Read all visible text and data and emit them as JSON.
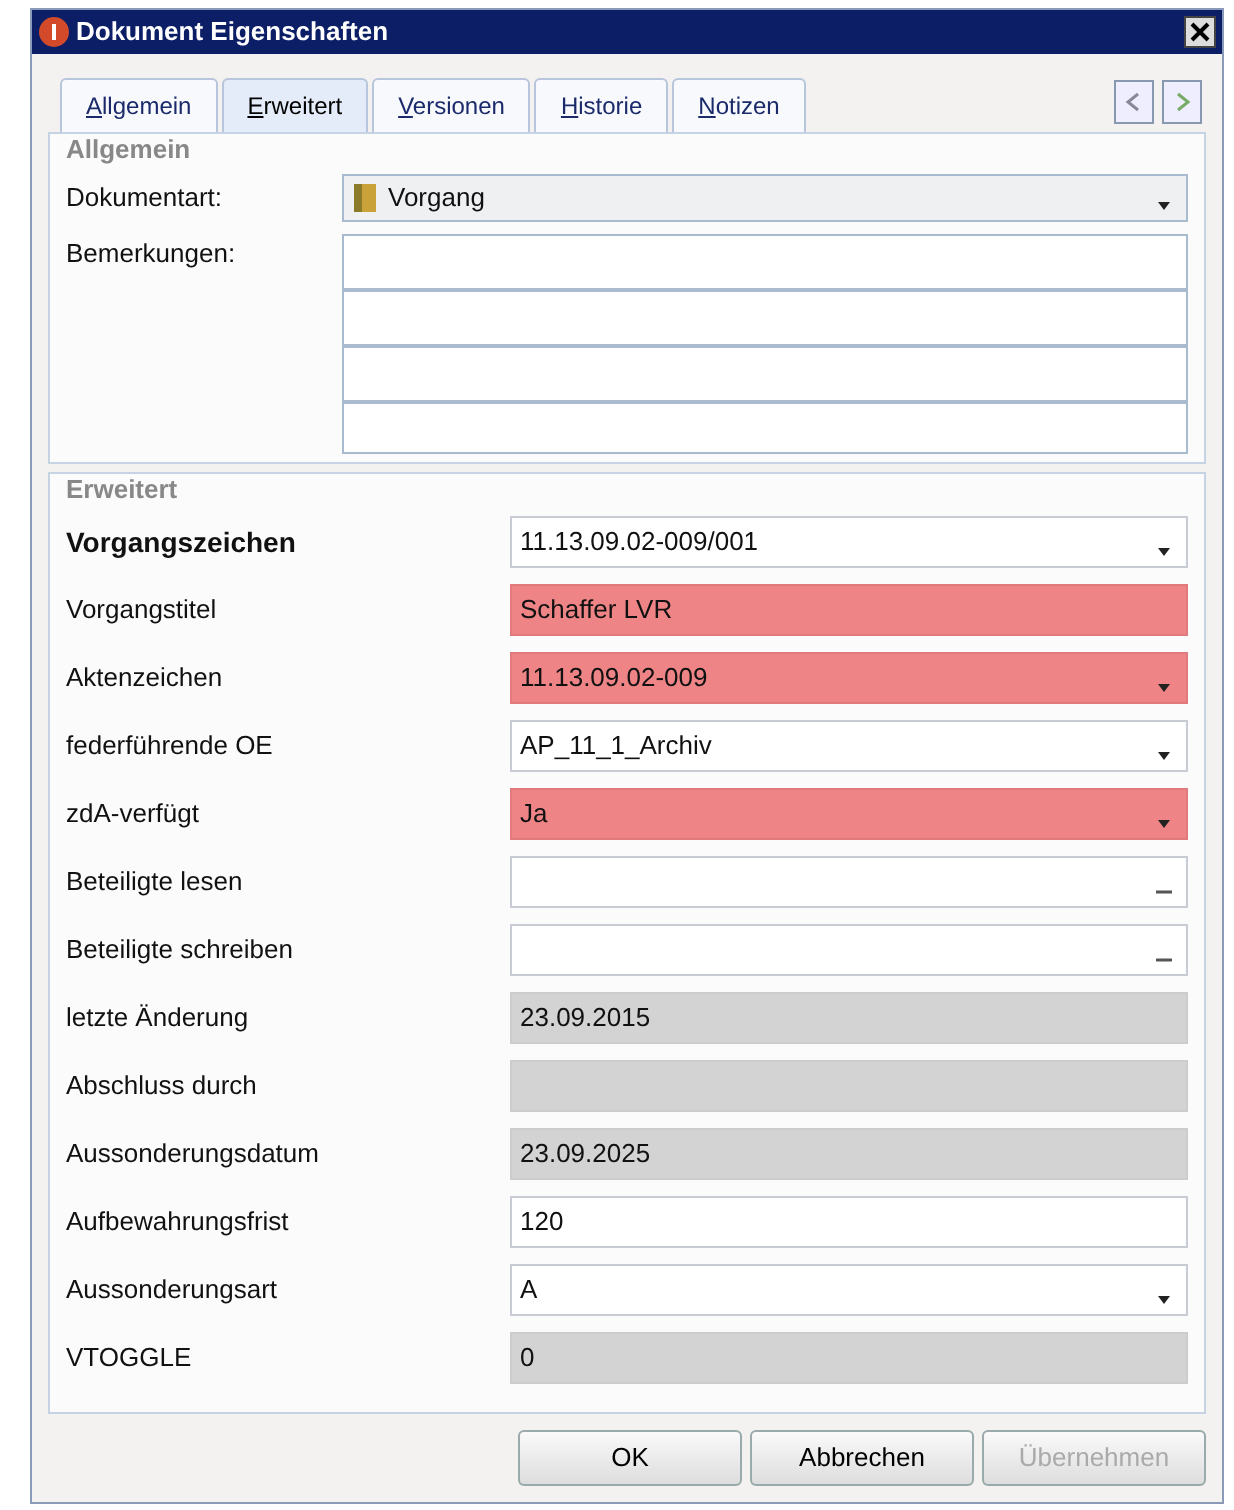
{
  "window": {
    "title": "Dokument Eigenschaften"
  },
  "tabs": [
    {
      "label": "Allgemein",
      "selected": false
    },
    {
      "label": "Erweitert",
      "selected": true
    },
    {
      "label": "Versionen",
      "selected": false
    },
    {
      "label": "Historie",
      "selected": false
    },
    {
      "label": "Notizen",
      "selected": false
    }
  ],
  "allgemein": {
    "title": "Allgemein",
    "dokumentart": {
      "label": "Dokumentart:",
      "value": "Vorgang"
    },
    "bemerkungen": {
      "label": "Bemerkungen:"
    }
  },
  "erweitert": {
    "title": "Erweitert",
    "fields": [
      {
        "label": "Vorgangszeichen",
        "emphasized": true,
        "kind": "dropdown",
        "value": "11.13.09.02-009/001",
        "required": false,
        "disabled": false
      },
      {
        "label": "Vorgangstitel",
        "emphasized": false,
        "kind": "text",
        "value": "Schaffer LVR",
        "required": true,
        "disabled": false
      },
      {
        "label": "Aktenzeichen",
        "emphasized": false,
        "kind": "dropdown",
        "value": "11.13.09.02-009",
        "required": true,
        "disabled": false
      },
      {
        "label": "federführende OE",
        "emphasized": false,
        "kind": "dropdown",
        "value": "AP_11_1_Archiv",
        "required": false,
        "disabled": false
      },
      {
        "label": "zdA-verfügt",
        "emphasized": false,
        "kind": "dropdown",
        "value": "Ja",
        "required": true,
        "disabled": false
      },
      {
        "label": "Beteiligte lesen",
        "emphasized": false,
        "kind": "lookup",
        "required": false,
        "disabled": false
      },
      {
        "label": "Beteiligte schreiben",
        "emphasized": false,
        "kind": "lookup",
        "required": false,
        "disabled": false
      },
      {
        "label": "letzte Änderung",
        "emphasized": false,
        "kind": "text",
        "value": "23.09.2015",
        "required": false,
        "disabled": true
      },
      {
        "label": "Abschluss durch",
        "emphasized": false,
        "kind": "text",
        "required": false,
        "disabled": true
      },
      {
        "label": "Aussonderungsdatum",
        "emphasized": false,
        "kind": "text",
        "value": "23.09.2025",
        "required": false,
        "disabled": true
      },
      {
        "label": "Aufbewahrungsfrist",
        "emphasized": false,
        "kind": "text",
        "value": "120",
        "required": false,
        "disabled": false
      },
      {
        "label": "Aussonderungsart",
        "emphasized": false,
        "kind": "dropdown",
        "value": "A",
        "required": false,
        "disabled": false
      },
      {
        "label": "VTOGGLE",
        "emphasized": false,
        "kind": "text",
        "value": "0",
        "required": false,
        "disabled": true
      }
    ]
  },
  "buttons": [
    {
      "label": "OK",
      "disabled": false
    },
    {
      "label": "Abbrechen",
      "disabled": false
    },
    {
      "label": "Übernehmen",
      "disabled": true
    }
  ]
}
